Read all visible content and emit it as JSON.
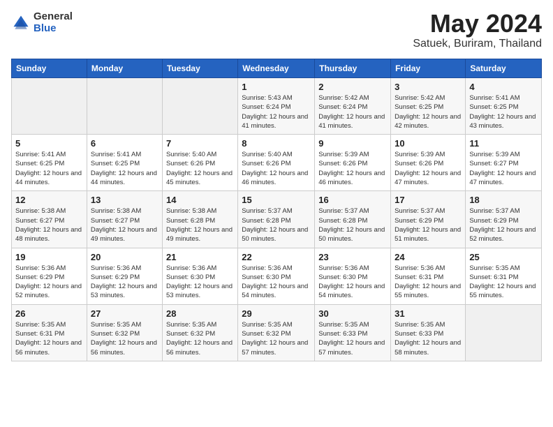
{
  "header": {
    "logo_general": "General",
    "logo_blue": "Blue",
    "title": "May 2024",
    "subtitle": "Satuek, Buriram, Thailand"
  },
  "days_of_week": [
    "Sunday",
    "Monday",
    "Tuesday",
    "Wednesday",
    "Thursday",
    "Friday",
    "Saturday"
  ],
  "weeks": [
    [
      {
        "day": "",
        "sunrise": "",
        "sunset": "",
        "daylight": "",
        "empty": true
      },
      {
        "day": "",
        "sunrise": "",
        "sunset": "",
        "daylight": "",
        "empty": true
      },
      {
        "day": "",
        "sunrise": "",
        "sunset": "",
        "daylight": "",
        "empty": true
      },
      {
        "day": "1",
        "sunrise": "Sunrise: 5:43 AM",
        "sunset": "Sunset: 6:24 PM",
        "daylight": "Daylight: 12 hours and 41 minutes.",
        "empty": false
      },
      {
        "day": "2",
        "sunrise": "Sunrise: 5:42 AM",
        "sunset": "Sunset: 6:24 PM",
        "daylight": "Daylight: 12 hours and 41 minutes.",
        "empty": false
      },
      {
        "day": "3",
        "sunrise": "Sunrise: 5:42 AM",
        "sunset": "Sunset: 6:25 PM",
        "daylight": "Daylight: 12 hours and 42 minutes.",
        "empty": false
      },
      {
        "day": "4",
        "sunrise": "Sunrise: 5:41 AM",
        "sunset": "Sunset: 6:25 PM",
        "daylight": "Daylight: 12 hours and 43 minutes.",
        "empty": false
      }
    ],
    [
      {
        "day": "5",
        "sunrise": "Sunrise: 5:41 AM",
        "sunset": "Sunset: 6:25 PM",
        "daylight": "Daylight: 12 hours and 44 minutes.",
        "empty": false
      },
      {
        "day": "6",
        "sunrise": "Sunrise: 5:41 AM",
        "sunset": "Sunset: 6:25 PM",
        "daylight": "Daylight: 12 hours and 44 minutes.",
        "empty": false
      },
      {
        "day": "7",
        "sunrise": "Sunrise: 5:40 AM",
        "sunset": "Sunset: 6:26 PM",
        "daylight": "Daylight: 12 hours and 45 minutes.",
        "empty": false
      },
      {
        "day": "8",
        "sunrise": "Sunrise: 5:40 AM",
        "sunset": "Sunset: 6:26 PM",
        "daylight": "Daylight: 12 hours and 46 minutes.",
        "empty": false
      },
      {
        "day": "9",
        "sunrise": "Sunrise: 5:39 AM",
        "sunset": "Sunset: 6:26 PM",
        "daylight": "Daylight: 12 hours and 46 minutes.",
        "empty": false
      },
      {
        "day": "10",
        "sunrise": "Sunrise: 5:39 AM",
        "sunset": "Sunset: 6:26 PM",
        "daylight": "Daylight: 12 hours and 47 minutes.",
        "empty": false
      },
      {
        "day": "11",
        "sunrise": "Sunrise: 5:39 AM",
        "sunset": "Sunset: 6:27 PM",
        "daylight": "Daylight: 12 hours and 47 minutes.",
        "empty": false
      }
    ],
    [
      {
        "day": "12",
        "sunrise": "Sunrise: 5:38 AM",
        "sunset": "Sunset: 6:27 PM",
        "daylight": "Daylight: 12 hours and 48 minutes.",
        "empty": false
      },
      {
        "day": "13",
        "sunrise": "Sunrise: 5:38 AM",
        "sunset": "Sunset: 6:27 PM",
        "daylight": "Daylight: 12 hours and 49 minutes.",
        "empty": false
      },
      {
        "day": "14",
        "sunrise": "Sunrise: 5:38 AM",
        "sunset": "Sunset: 6:28 PM",
        "daylight": "Daylight: 12 hours and 49 minutes.",
        "empty": false
      },
      {
        "day": "15",
        "sunrise": "Sunrise: 5:37 AM",
        "sunset": "Sunset: 6:28 PM",
        "daylight": "Daylight: 12 hours and 50 minutes.",
        "empty": false
      },
      {
        "day": "16",
        "sunrise": "Sunrise: 5:37 AM",
        "sunset": "Sunset: 6:28 PM",
        "daylight": "Daylight: 12 hours and 50 minutes.",
        "empty": false
      },
      {
        "day": "17",
        "sunrise": "Sunrise: 5:37 AM",
        "sunset": "Sunset: 6:29 PM",
        "daylight": "Daylight: 12 hours and 51 minutes.",
        "empty": false
      },
      {
        "day": "18",
        "sunrise": "Sunrise: 5:37 AM",
        "sunset": "Sunset: 6:29 PM",
        "daylight": "Daylight: 12 hours and 52 minutes.",
        "empty": false
      }
    ],
    [
      {
        "day": "19",
        "sunrise": "Sunrise: 5:36 AM",
        "sunset": "Sunset: 6:29 PM",
        "daylight": "Daylight: 12 hours and 52 minutes.",
        "empty": false
      },
      {
        "day": "20",
        "sunrise": "Sunrise: 5:36 AM",
        "sunset": "Sunset: 6:29 PM",
        "daylight": "Daylight: 12 hours and 53 minutes.",
        "empty": false
      },
      {
        "day": "21",
        "sunrise": "Sunrise: 5:36 AM",
        "sunset": "Sunset: 6:30 PM",
        "daylight": "Daylight: 12 hours and 53 minutes.",
        "empty": false
      },
      {
        "day": "22",
        "sunrise": "Sunrise: 5:36 AM",
        "sunset": "Sunset: 6:30 PM",
        "daylight": "Daylight: 12 hours and 54 minutes.",
        "empty": false
      },
      {
        "day": "23",
        "sunrise": "Sunrise: 5:36 AM",
        "sunset": "Sunset: 6:30 PM",
        "daylight": "Daylight: 12 hours and 54 minutes.",
        "empty": false
      },
      {
        "day": "24",
        "sunrise": "Sunrise: 5:36 AM",
        "sunset": "Sunset: 6:31 PM",
        "daylight": "Daylight: 12 hours and 55 minutes.",
        "empty": false
      },
      {
        "day": "25",
        "sunrise": "Sunrise: 5:35 AM",
        "sunset": "Sunset: 6:31 PM",
        "daylight": "Daylight: 12 hours and 55 minutes.",
        "empty": false
      }
    ],
    [
      {
        "day": "26",
        "sunrise": "Sunrise: 5:35 AM",
        "sunset": "Sunset: 6:31 PM",
        "daylight": "Daylight: 12 hours and 56 minutes.",
        "empty": false
      },
      {
        "day": "27",
        "sunrise": "Sunrise: 5:35 AM",
        "sunset": "Sunset: 6:32 PM",
        "daylight": "Daylight: 12 hours and 56 minutes.",
        "empty": false
      },
      {
        "day": "28",
        "sunrise": "Sunrise: 5:35 AM",
        "sunset": "Sunset: 6:32 PM",
        "daylight": "Daylight: 12 hours and 56 minutes.",
        "empty": false
      },
      {
        "day": "29",
        "sunrise": "Sunrise: 5:35 AM",
        "sunset": "Sunset: 6:32 PM",
        "daylight": "Daylight: 12 hours and 57 minutes.",
        "empty": false
      },
      {
        "day": "30",
        "sunrise": "Sunrise: 5:35 AM",
        "sunset": "Sunset: 6:33 PM",
        "daylight": "Daylight: 12 hours and 57 minutes.",
        "empty": false
      },
      {
        "day": "31",
        "sunrise": "Sunrise: 5:35 AM",
        "sunset": "Sunset: 6:33 PM",
        "daylight": "Daylight: 12 hours and 58 minutes.",
        "empty": false
      },
      {
        "day": "",
        "sunrise": "",
        "sunset": "",
        "daylight": "",
        "empty": true
      }
    ]
  ]
}
